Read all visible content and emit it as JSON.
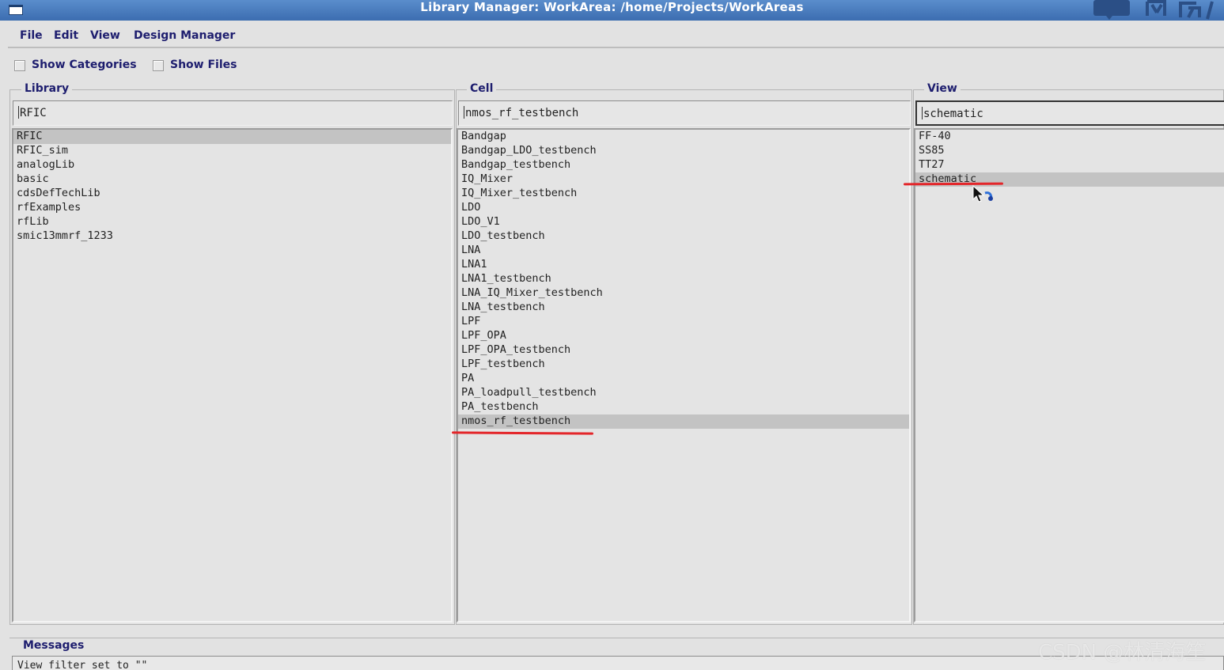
{
  "window": {
    "title": "Library Manager: WorkArea: /home/Projects/WorkAreas"
  },
  "menu": {
    "file": "File",
    "edit": "Edit",
    "view": "View",
    "design_manager": "Design Manager"
  },
  "options": {
    "show_categories": "Show Categories",
    "show_files": "Show Files"
  },
  "library": {
    "label": "Library",
    "filter": "RFIC",
    "items": [
      "RFIC",
      "RFIC_sim",
      "analogLib",
      "basic",
      "cdsDefTechLib",
      "rfExamples",
      "rfLib",
      "smic13mmrf_1233"
    ],
    "selected": "RFIC"
  },
  "cell": {
    "label": "Cell",
    "filter": "nmos_rf_testbench",
    "items": [
      "Bandgap",
      "Bandgap_LDO_testbench",
      "Bandgap_testbench",
      "IQ_Mixer",
      "IQ_Mixer_testbench",
      "LDO",
      "LDO_V1",
      "LDO_testbench",
      "LNA",
      "LNA1",
      "LNA1_testbench",
      "LNA_IQ_Mixer_testbench",
      "LNA_testbench",
      "LPF",
      "LPF_OPA",
      "LPF_OPA_testbench",
      "LPF_testbench",
      "PA",
      "PA_loadpull_testbench",
      "PA_testbench",
      "nmos_rf_testbench"
    ],
    "selected": "nmos_rf_testbench"
  },
  "view": {
    "label": "View",
    "filter": "schematic",
    "items": [
      "FF-40",
      "SS85",
      "TT27",
      "schematic"
    ],
    "selected": "schematic"
  },
  "messages": {
    "label": "Messages",
    "text": "View filter set to \"\""
  },
  "watermark": "CSDN @林清海笙",
  "colors": {
    "title_bar": "#3c6db0",
    "selection": "#c3c3c3",
    "annotation": "#e3262a",
    "label_text": "#1d1d6e"
  }
}
